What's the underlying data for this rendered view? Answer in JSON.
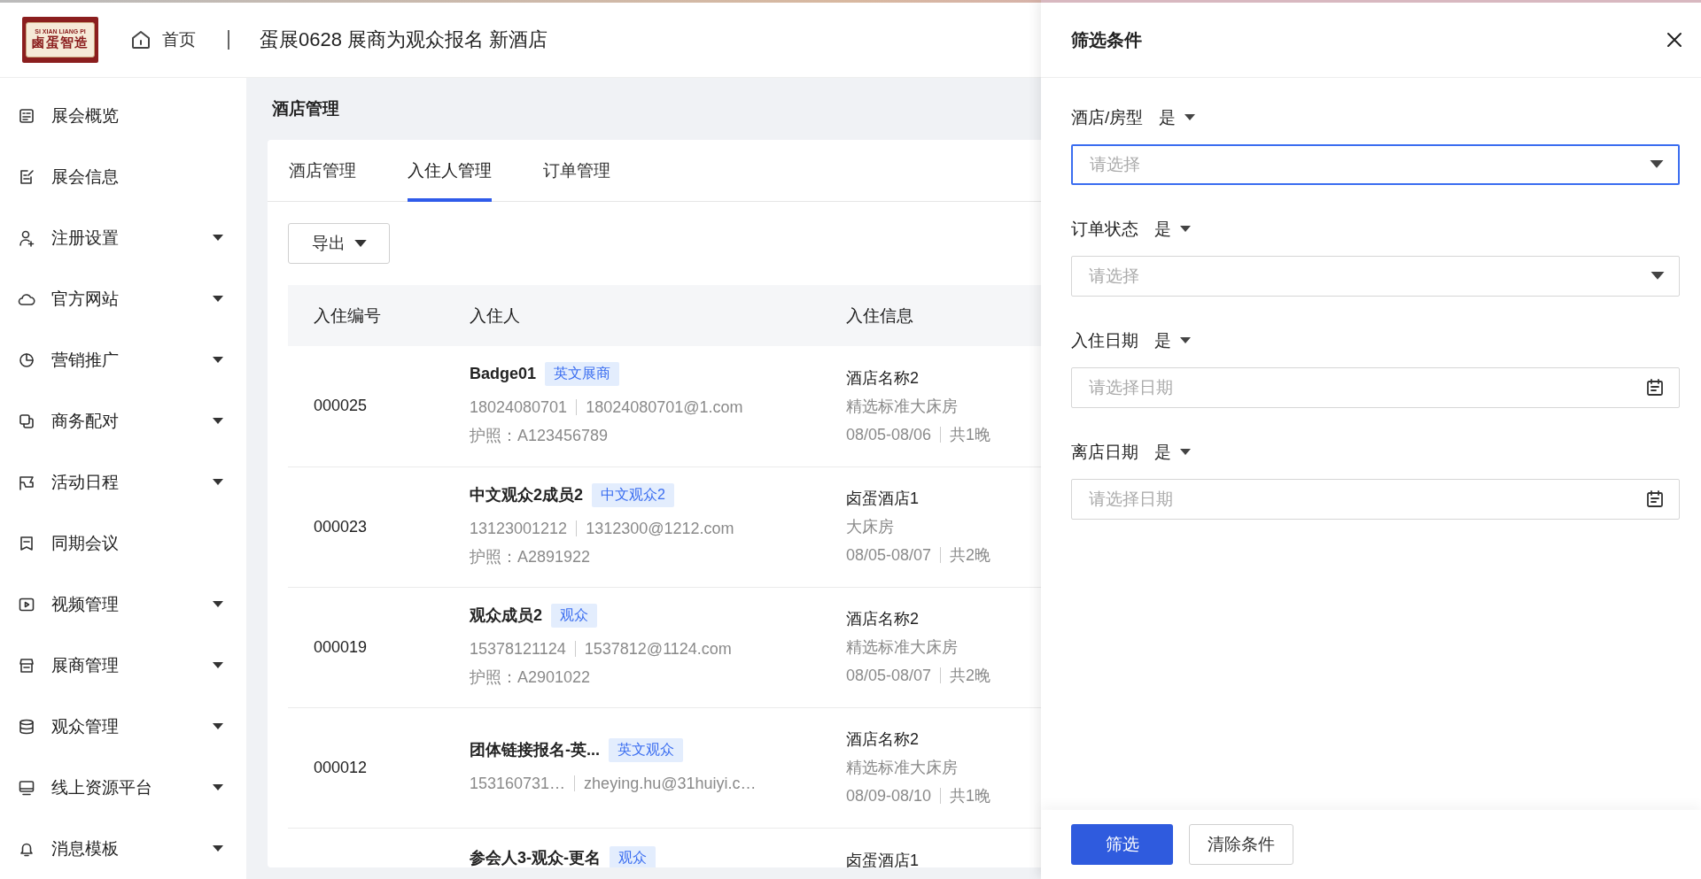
{
  "header": {
    "logo": {
      "top_text": "SI XIAN LIANG PI",
      "main_text": "鹵蛋智造"
    },
    "home_link": "首页",
    "title": "蛋展0628 展商为观众报名 新酒店"
  },
  "sidebar": {
    "items": [
      {
        "label": "展会概览",
        "has_submenu": false
      },
      {
        "label": "展会信息",
        "has_submenu": false
      },
      {
        "label": "注册设置",
        "has_submenu": true
      },
      {
        "label": "官方网站",
        "has_submenu": true
      },
      {
        "label": "营销推广",
        "has_submenu": true
      },
      {
        "label": "商务配对",
        "has_submenu": true
      },
      {
        "label": "活动日程",
        "has_submenu": true
      },
      {
        "label": "同期会议",
        "has_submenu": false
      },
      {
        "label": "视频管理",
        "has_submenu": true
      },
      {
        "label": "展商管理",
        "has_submenu": true
      },
      {
        "label": "观众管理",
        "has_submenu": true
      },
      {
        "label": "线上资源平台",
        "has_submenu": true
      },
      {
        "label": "消息模板",
        "has_submenu": true
      }
    ]
  },
  "page_title": "酒店管理",
  "tabs": [
    {
      "label": "酒店管理",
      "selected": false
    },
    {
      "label": "入住人管理",
      "selected": true
    },
    {
      "label": "订单管理",
      "selected": false
    }
  ],
  "export_button": "导出",
  "table": {
    "columns": [
      "入住编号",
      "入住人",
      "入住信息"
    ],
    "rows": [
      {
        "id": "000025",
        "name": "Badge01",
        "tag": "英文展商",
        "phone": "18024080701",
        "email": "18024080701@1.com",
        "passport": "护照：A123456789",
        "hotel": "酒店名称2",
        "room": "精选标准大床房",
        "dates": "08/05-08/06",
        "nights": "共1晚"
      },
      {
        "id": "000023",
        "name": "中文观众2成员2",
        "tag": "中文观众2",
        "phone": "13123001212",
        "email": "1312300@1212.com",
        "passport": "护照：A2891922",
        "hotel": "卤蛋酒店1",
        "room": "大床房",
        "dates": "08/05-08/07",
        "nights": "共2晚"
      },
      {
        "id": "000019",
        "name": "观众成员2",
        "tag": "观众",
        "phone": "15378121124",
        "email": "1537812@1124.com",
        "passport": "护照：A2901022",
        "hotel": "酒店名称2",
        "room": "精选标准大床房",
        "dates": "08/05-08/07",
        "nights": "共2晚"
      },
      {
        "id": "000012",
        "name": "团体链接报名-英...",
        "tag": "英文观众",
        "phone": "153160731…",
        "email": "zheying.hu@31huiyi.c…",
        "hotel": "酒店名称2",
        "room": "精选标准大床房",
        "dates": "08/09-08/10",
        "nights": "共1晚"
      },
      {
        "name": "参会人3-观众-更名",
        "tag": "观众",
        "hotel": "卤蛋酒店1"
      }
    ]
  },
  "drawer": {
    "title": "筛选条件",
    "fields": [
      {
        "label": "酒店/房型",
        "condition": "是",
        "kind": "select",
        "placeholder": "请选择",
        "focused": true
      },
      {
        "label": "订单状态",
        "condition": "是",
        "kind": "select",
        "placeholder": "请选择",
        "focused": false
      },
      {
        "label": "入住日期",
        "condition": "是",
        "kind": "date",
        "placeholder": "请选择日期",
        "focused": false
      },
      {
        "label": "离店日期",
        "condition": "是",
        "kind": "date",
        "placeholder": "请选择日期",
        "focused": false
      }
    ],
    "buttons": [
      {
        "label": "筛选",
        "kind": "primary"
      },
      {
        "label": "清除条件",
        "kind": "default"
      }
    ]
  }
}
